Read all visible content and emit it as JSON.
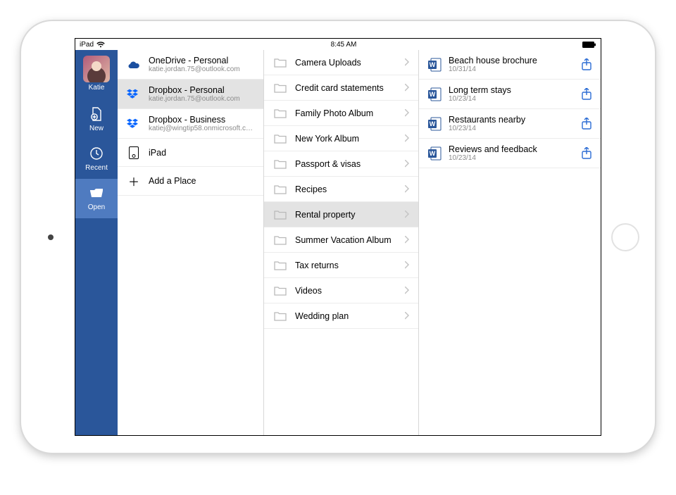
{
  "statusbar": {
    "carrier": "iPad",
    "time": "8:45 AM"
  },
  "sidebar": {
    "user": "Katie",
    "items": [
      {
        "key": "new",
        "label": "New"
      },
      {
        "key": "recent",
        "label": "Recent"
      },
      {
        "key": "open",
        "label": "Open"
      }
    ],
    "active": "open"
  },
  "places": [
    {
      "icon": "onedrive",
      "title": "OneDrive - Personal",
      "sub": "katie.jordan.75@outlook.com"
    },
    {
      "icon": "dropbox",
      "title": "Dropbox - Personal",
      "sub": "katie.jordan.75@outlook.com",
      "selected": true
    },
    {
      "icon": "dropbox",
      "title": "Dropbox - Business",
      "sub": "katiej@wingtip58.onmicrosoft.com"
    },
    {
      "icon": "ipad",
      "title": "iPad"
    },
    {
      "icon": "add",
      "title": "Add a Place"
    }
  ],
  "folders": [
    {
      "name": "Camera Uploads"
    },
    {
      "name": "Credit card statements"
    },
    {
      "name": "Family Photo Album"
    },
    {
      "name": "New York Album"
    },
    {
      "name": "Passport & visas"
    },
    {
      "name": "Recipes"
    },
    {
      "name": "Rental property",
      "selected": true
    },
    {
      "name": "Summer Vacation Album"
    },
    {
      "name": "Tax returns"
    },
    {
      "name": "Videos"
    },
    {
      "name": "Wedding plan"
    }
  ],
  "files": [
    {
      "name": "Beach house brochure",
      "date": "10/31/14"
    },
    {
      "name": "Long term stays",
      "date": "10/23/14"
    },
    {
      "name": "Restaurants nearby",
      "date": "10/23/14"
    },
    {
      "name": "Reviews and feedback",
      "date": "10/23/14"
    }
  ]
}
